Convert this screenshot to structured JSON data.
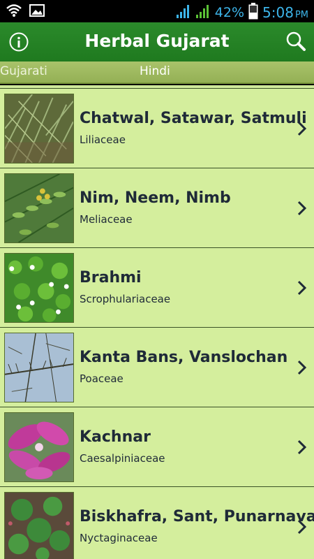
{
  "status_bar": {
    "battery_percent": "42%",
    "time": "5:08",
    "ampm": "PM",
    "icons": [
      "wifi-icon",
      "gallery-icon",
      "signal-icon",
      "signal-2-icon",
      "battery-icon"
    ]
  },
  "action_bar": {
    "title": "Herbal Gujarat",
    "info_icon": "info-icon",
    "search_icon": "search-icon"
  },
  "tabs": [
    {
      "label": "Gujarati"
    },
    {
      "label": "Hindi"
    }
  ],
  "plants": [
    {
      "name": "Chatwal, Satawar, Satmuli",
      "family": "Liliaceae"
    },
    {
      "name": "Nim, Neem, Nimb",
      "family": "Meliaceae"
    },
    {
      "name": "Brahmi",
      "family": "Scrophulariaceae"
    },
    {
      "name": "Kanta Bans, Vanslochan",
      "family": "Poaceae"
    },
    {
      "name": "Kachnar",
      "family": "Caesalpiniaceae"
    },
    {
      "name": "Biskhafra, Sant, Punarnava",
      "family": "Nyctaginaceae"
    }
  ],
  "colors": {
    "action_bar": "#2b8a2b",
    "tab_strip": "#a9c36a",
    "list_bg": "#d4ee9d",
    "status_text": "#3db5ea"
  }
}
